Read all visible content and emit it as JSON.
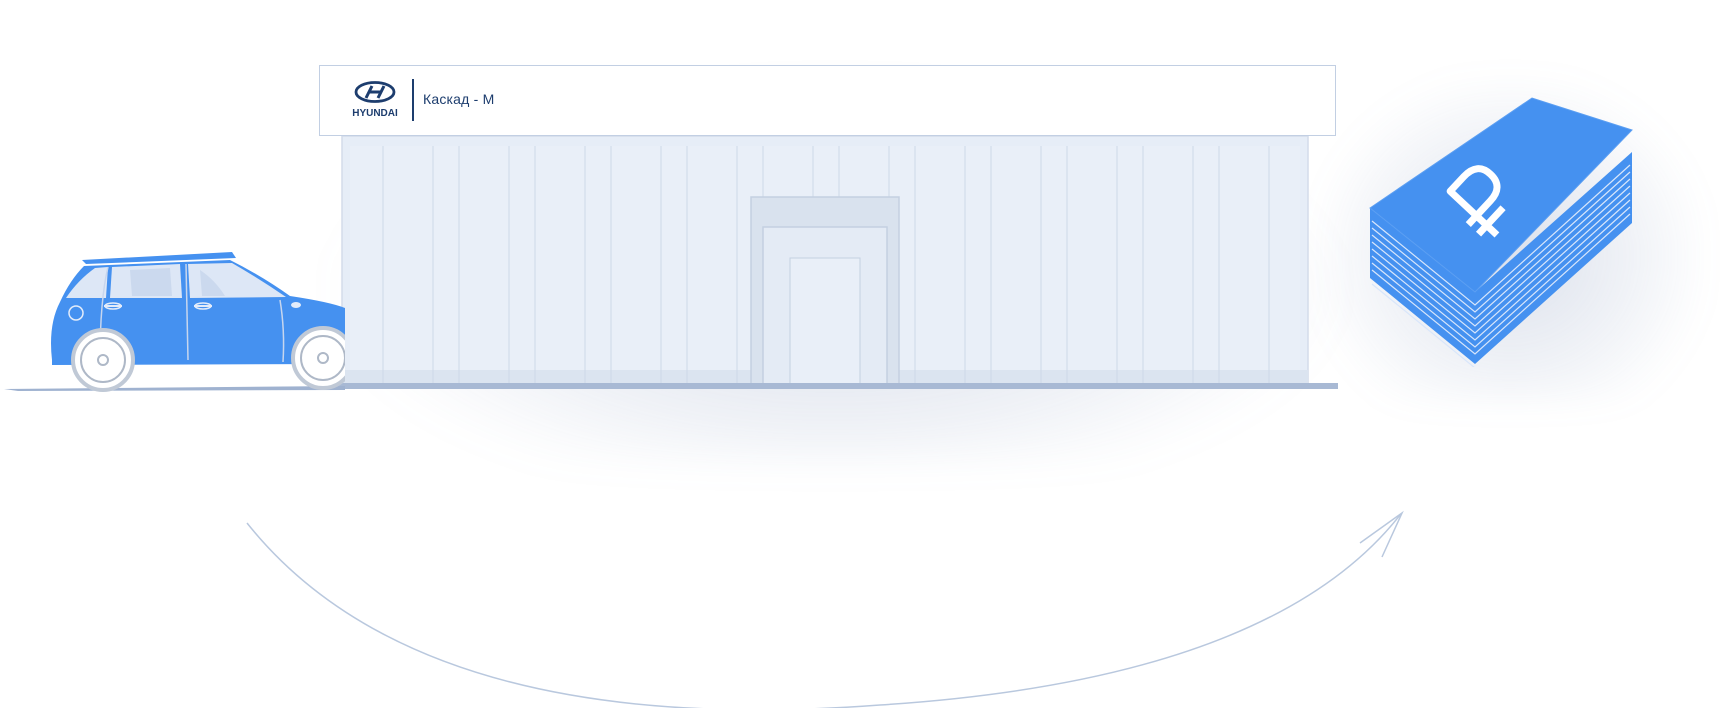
{
  "sign": {
    "brand": "HYUNDAI",
    "dealer_name": "Каскад - М"
  },
  "money": {
    "currency_symbol": "₽"
  },
  "colors": {
    "accent_blue": "#4591f0",
    "building_fill": "#e6edf7",
    "outline": "#c2cfe3",
    "logo_navy": "#1d3d6e"
  },
  "icons": [
    "car-icon",
    "dealership-building",
    "hyundai-logo-icon",
    "ruble-money-stack-icon",
    "curved-arrow-icon"
  ]
}
